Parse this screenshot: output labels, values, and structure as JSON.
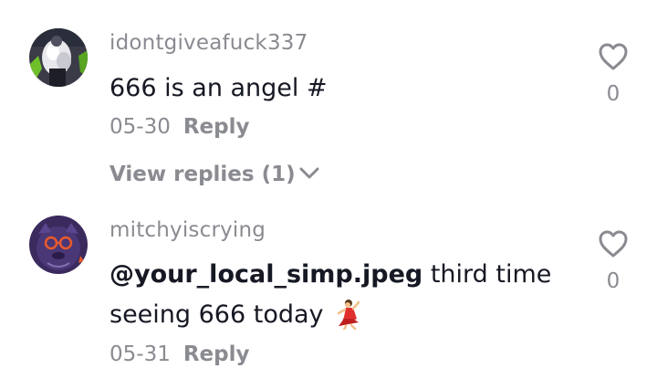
{
  "comments": [
    {
      "username": "idontgiveafuck337",
      "text": "666 is an angel #",
      "date": "05-30",
      "reply_label": "Reply",
      "view_replies_label": "View replies (1)",
      "like_count": "0",
      "avatar_icon": "avatar-photo"
    },
    {
      "username": "mitchyiscrying",
      "mention": "@your_local_simp.jpeg",
      "text_line1": " third time",
      "text_line2": "seeing 666 today",
      "emoji": "dancer-emoji",
      "date": "05-31",
      "reply_label": "Reply",
      "like_count": "0",
      "avatar_icon": "avatar-drawing"
    }
  ],
  "colors": {
    "text_primary": "#161823",
    "text_secondary": "#8a8b91",
    "background": "#ffffff"
  }
}
